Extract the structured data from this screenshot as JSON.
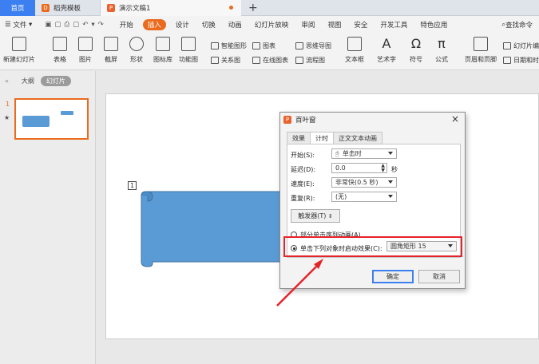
{
  "tabs": {
    "home": "首页",
    "template": "稻壳模板",
    "doc": "演示文稿1"
  },
  "menu": {
    "file": "文件",
    "items": [
      "开始",
      "插入",
      "设计",
      "切换",
      "动画",
      "幻灯片放映",
      "审阅",
      "视图",
      "安全",
      "开发工具",
      "特色应用"
    ],
    "active_index": 1,
    "search": "查找命令"
  },
  "ribbon": {
    "new_slide": "新建幻灯片",
    "table": "表格",
    "picture": "图片",
    "screenshot": "截屏",
    "shape": "形状",
    "icon_lib": "图标库",
    "func_chart": "功能图",
    "smart_shape": "智能图形",
    "chart": "图表",
    "mindmap": "思维导图",
    "relation": "关系图",
    "online_chart": "在线图表",
    "flowchart": "流程图",
    "textbox": "文本框",
    "wordart": "艺术字",
    "symbol": "符号",
    "formula": "公式",
    "header_footer": "页眉和页脚",
    "slide_num": "幻灯片编",
    "datetime": "日期和时"
  },
  "left_pane": {
    "outline": "大纲",
    "slides": "幻灯片",
    "slide_number": "1",
    "star": "★"
  },
  "canvas": {
    "anim_tag": "1",
    "shape_color": "#5b9bd5"
  },
  "dialog": {
    "title": "百叶窗",
    "tabs": [
      "效果",
      "计时",
      "正文文本动画"
    ],
    "selected_tab": 1,
    "start_label": "开始(S):",
    "start_value": "单击时",
    "delay_label": "延迟(D):",
    "delay_value": "0.0",
    "delay_unit": "秒",
    "speed_label": "速度(E):",
    "speed_value": "非常快(0.5 秒)",
    "repeat_label": "重复(R):",
    "repeat_value": "(无)",
    "trigger_label": "触发器(T)",
    "radio1": "部分单击序列动画(A)",
    "radio2": "单击下列对象时启动效果(C):",
    "target_value": "圆角矩形 15",
    "ok": "确定",
    "cancel": "取消"
  },
  "colors": {
    "accent": "#ea6b1e",
    "highlight": "#e5242a",
    "home_tab": "#3c7ff0"
  }
}
